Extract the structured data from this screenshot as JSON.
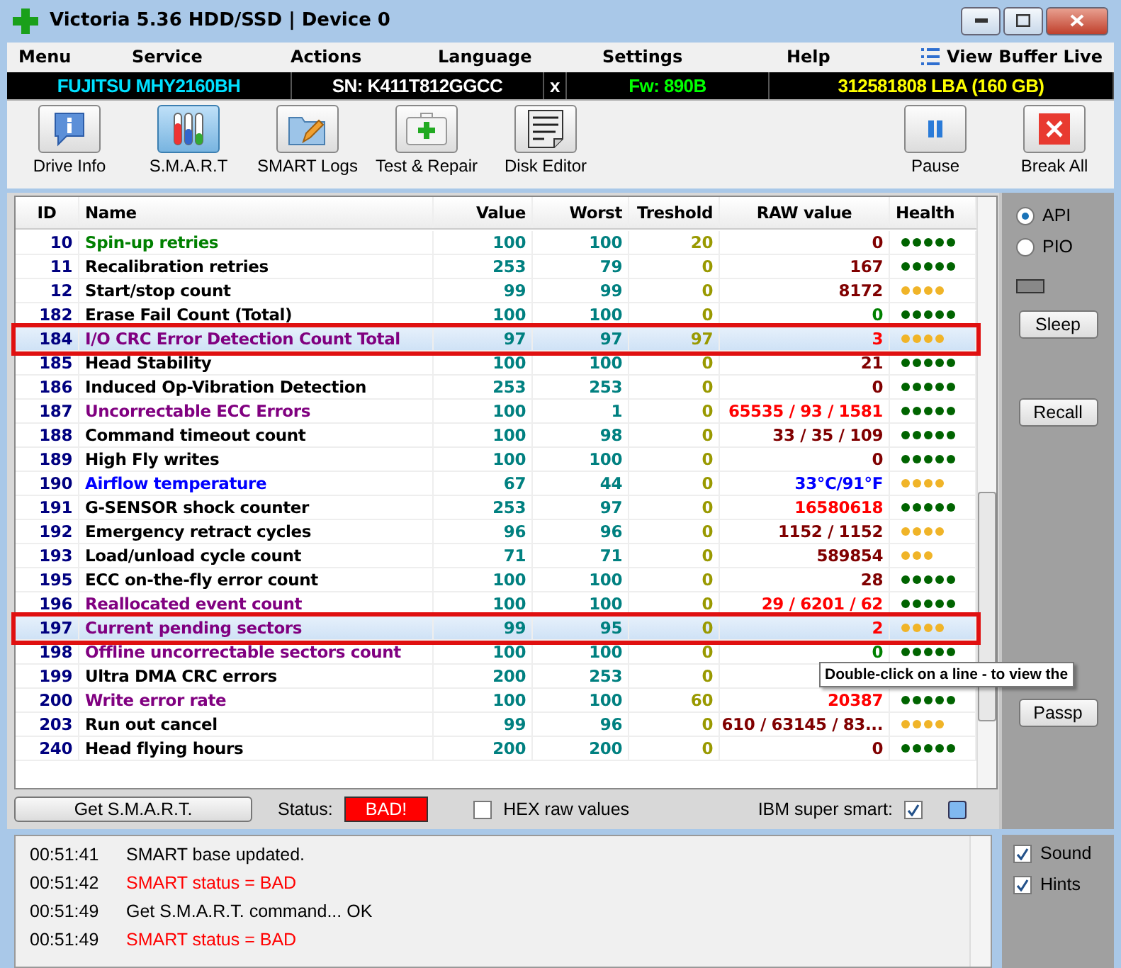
{
  "window": {
    "title": "Victoria 5.36 HDD/SSD | Device 0"
  },
  "menu": [
    {
      "label": "Menu"
    },
    {
      "label": "Service"
    },
    {
      "label": "Actions"
    },
    {
      "label": "Language"
    },
    {
      "label": "Settings"
    },
    {
      "label": "Help"
    },
    {
      "label": "View Buffer Live",
      "kind": "list"
    }
  ],
  "drive_info": [
    {
      "text": "FUJITSU MHY2160BH",
      "color": "#00e0ff"
    },
    {
      "text": "SN: K411T812GGCC",
      "color": "#ffffff"
    },
    {
      "text": "x",
      "color": "#ffffff"
    },
    {
      "text": "Fw: 890B",
      "color": "#00ff00"
    },
    {
      "text": "312581808 LBA (160 GB)",
      "color": "#ffff00"
    }
  ],
  "toolbar": [
    {
      "label": "Drive Info",
      "kind": "info",
      "selected": false
    },
    {
      "label": "S.M.A.R.T",
      "kind": "tubes",
      "selected": true
    },
    {
      "label": "SMART Logs",
      "kind": "folder",
      "selected": false
    },
    {
      "label": "Test & Repair",
      "kind": "kit",
      "selected": false
    },
    {
      "label": "Disk Editor",
      "kind": "binary",
      "selected": false
    }
  ],
  "toolbar_right": [
    {
      "label": "Pause",
      "kind": "pause"
    },
    {
      "label": "Break All",
      "kind": "stop"
    }
  ],
  "table": {
    "columns": [
      "ID",
      "Name",
      "Value",
      "Worst",
      "Treshold",
      "RAW value",
      "Health"
    ],
    "rows": [
      {
        "id": "10",
        "name": {
          "text": "Spin-up retries",
          "color": "#008000"
        },
        "value": "100",
        "worst": "100",
        "threshold": "20",
        "raw": {
          "text": "0",
          "color": "#800000"
        },
        "health": {
          "stars": 5,
          "color": "#006400"
        },
        "selected": false
      },
      {
        "id": "11",
        "name": {
          "text": "Recalibration retries",
          "color": "#000000"
        },
        "value": "253",
        "worst": "79",
        "threshold": "0",
        "raw": {
          "text": "167",
          "color": "#800000"
        },
        "health": {
          "stars": 5,
          "color": "#006400"
        },
        "selected": false
      },
      {
        "id": "12",
        "name": {
          "text": "Start/stop count",
          "color": "#000000"
        },
        "value": "99",
        "worst": "99",
        "threshold": "0",
        "raw": {
          "text": "8172",
          "color": "#800000"
        },
        "health": {
          "stars": 4,
          "color": "#f0b428"
        },
        "selected": false
      },
      {
        "id": "182",
        "name": {
          "text": "Erase Fail Count (Total)",
          "color": "#000000"
        },
        "value": "100",
        "worst": "100",
        "threshold": "0",
        "raw": {
          "text": "0",
          "color": "#008000"
        },
        "health": {
          "stars": 5,
          "color": "#006400"
        },
        "selected": false
      },
      {
        "id": "184",
        "name": {
          "text": "I/O CRC Error Detection Count Total",
          "color": "#800080"
        },
        "value": "97",
        "worst": "97",
        "threshold": "97",
        "raw": {
          "text": "3",
          "color": "#ff0000"
        },
        "health": {
          "stars": 4,
          "color": "#f0b428"
        },
        "selected": true
      },
      {
        "id": "185",
        "name": {
          "text": "Head Stability",
          "color": "#000000"
        },
        "value": "100",
        "worst": "100",
        "threshold": "0",
        "raw": {
          "text": "21",
          "color": "#800000"
        },
        "health": {
          "stars": 5,
          "color": "#006400"
        },
        "selected": false
      },
      {
        "id": "186",
        "name": {
          "text": "Induced Op-Vibration Detection",
          "color": "#000000"
        },
        "value": "253",
        "worst": "253",
        "threshold": "0",
        "raw": {
          "text": "0",
          "color": "#800000"
        },
        "health": {
          "stars": 5,
          "color": "#006400"
        },
        "selected": false
      },
      {
        "id": "187",
        "name": {
          "text": "Uncorrectable ECC Errors",
          "color": "#800080"
        },
        "value": "100",
        "worst": "1",
        "threshold": "0",
        "raw": {
          "text": "65535 / 93 / 1581",
          "color": "#ff0000"
        },
        "health": {
          "stars": 5,
          "color": "#006400"
        },
        "selected": false
      },
      {
        "id": "188",
        "name": {
          "text": "Command timeout count",
          "color": "#000000"
        },
        "value": "100",
        "worst": "98",
        "threshold": "0",
        "raw": {
          "text": "33 / 35 / 109",
          "color": "#800000"
        },
        "health": {
          "stars": 5,
          "color": "#006400"
        },
        "selected": false
      },
      {
        "id": "189",
        "name": {
          "text": "High Fly writes",
          "color": "#000000"
        },
        "value": "100",
        "worst": "100",
        "threshold": "0",
        "raw": {
          "text": "0",
          "color": "#800000"
        },
        "health": {
          "stars": 5,
          "color": "#006400"
        },
        "selected": false
      },
      {
        "id": "190",
        "name": {
          "text": "Airflow temperature",
          "color": "#0000ff"
        },
        "value": "67",
        "worst": "44",
        "threshold": "0",
        "raw": {
          "text": "33°C/91°F",
          "color": "#0000ff"
        },
        "health": {
          "stars": 4,
          "color": "#f0b428"
        },
        "selected": false
      },
      {
        "id": "191",
        "name": {
          "text": "G-SENSOR shock counter",
          "color": "#000000"
        },
        "value": "253",
        "worst": "97",
        "threshold": "0",
        "raw": {
          "text": "16580618",
          "color": "#ff0000"
        },
        "health": {
          "stars": 5,
          "color": "#006400"
        },
        "selected": false
      },
      {
        "id": "192",
        "name": {
          "text": "Emergency retract cycles",
          "color": "#000000"
        },
        "value": "96",
        "worst": "96",
        "threshold": "0",
        "raw": {
          "text": "1152 / 1152",
          "color": "#800000"
        },
        "health": {
          "stars": 4,
          "color": "#f0b428"
        },
        "selected": false
      },
      {
        "id": "193",
        "name": {
          "text": "Load/unload cycle count",
          "color": "#000000"
        },
        "value": "71",
        "worst": "71",
        "threshold": "0",
        "raw": {
          "text": "589854",
          "color": "#800000"
        },
        "health": {
          "stars": 3,
          "color": "#f0b428"
        },
        "selected": false
      },
      {
        "id": "195",
        "name": {
          "text": "ECC on-the-fly error count",
          "color": "#000000"
        },
        "value": "100",
        "worst": "100",
        "threshold": "0",
        "raw": {
          "text": "28",
          "color": "#800000"
        },
        "health": {
          "stars": 5,
          "color": "#006400"
        },
        "selected": false
      },
      {
        "id": "196",
        "name": {
          "text": "Reallocated event count",
          "color": "#800080"
        },
        "value": "100",
        "worst": "100",
        "threshold": "0",
        "raw": {
          "text": "29 / 6201 / 62",
          "color": "#ff0000"
        },
        "health": {
          "stars": 5,
          "color": "#006400"
        },
        "selected": false
      },
      {
        "id": "197",
        "name": {
          "text": "Current pending sectors",
          "color": "#800080"
        },
        "value": "99",
        "worst": "95",
        "threshold": "0",
        "raw": {
          "text": "2",
          "color": "#ff0000"
        },
        "health": {
          "stars": 4,
          "color": "#f0b428"
        },
        "selected": true
      },
      {
        "id": "198",
        "name": {
          "text": "Offline uncorrectable sectors count",
          "color": "#800080"
        },
        "value": "100",
        "worst": "100",
        "threshold": "0",
        "raw": {
          "text": "0",
          "color": "#008000"
        },
        "health": {
          "stars": 5,
          "color": "#006400"
        },
        "selected": false
      },
      {
        "id": "199",
        "name": {
          "text": "Ultra DMA CRC errors",
          "color": "#000000"
        },
        "value": "200",
        "worst": "253",
        "threshold": "0",
        "selected": false
      },
      {
        "id": "200",
        "name": {
          "text": "Write error rate",
          "color": "#800080"
        },
        "value": "100",
        "worst": "100",
        "threshold": "60",
        "raw": {
          "text": "20387",
          "color": "#ff0000"
        },
        "health": {
          "stars": 5,
          "color": "#006400"
        },
        "selected": false
      },
      {
        "id": "203",
        "name": {
          "text": "Run out cancel",
          "color": "#000000"
        },
        "value": "99",
        "worst": "96",
        "threshold": "0",
        "raw": {
          "text": "610 / 63145 / 83...",
          "color": "#800000"
        },
        "health": {
          "stars": 4,
          "color": "#f0b428"
        },
        "selected": false
      },
      {
        "id": "240",
        "name": {
          "text": "Head flying hours",
          "color": "#000000"
        },
        "value": "200",
        "worst": "200",
        "threshold": "0",
        "raw": {
          "text": "0",
          "color": "#800000"
        },
        "health": {
          "stars": 5,
          "color": "#006400"
        },
        "selected": false
      }
    ]
  },
  "tooltip": {
    "text": "Double-click on a line - to view the"
  },
  "bottom_bar": {
    "button": "Get S.M.A.R.T.",
    "status_label": "Status:",
    "status": "BAD!",
    "hex": {
      "label": "HEX raw values",
      "checked": false
    },
    "ibm": {
      "label": "IBM super smart:",
      "checked": true
    }
  },
  "side_panel": {
    "modes": [
      {
        "label": "API",
        "selected": true
      },
      {
        "label": "PIO",
        "selected": false
      }
    ],
    "buttons": [
      "Sleep",
      "Recall",
      "Passp"
    ]
  },
  "log": [
    {
      "time": "00:51:41",
      "text": "SMART base updated.",
      "color": "#000000"
    },
    {
      "time": "00:51:42",
      "text": "SMART status = BAD",
      "color": "#ff0000"
    },
    {
      "time": "00:51:49",
      "text": "Get S.M.A.R.T. command... OK",
      "color": "#000000"
    },
    {
      "time": "00:51:49",
      "text": "SMART status = BAD",
      "color": "#ff0000"
    }
  ],
  "options": [
    {
      "label": "Sound",
      "checked": true
    },
    {
      "label": "Hints",
      "checked": true
    }
  ]
}
